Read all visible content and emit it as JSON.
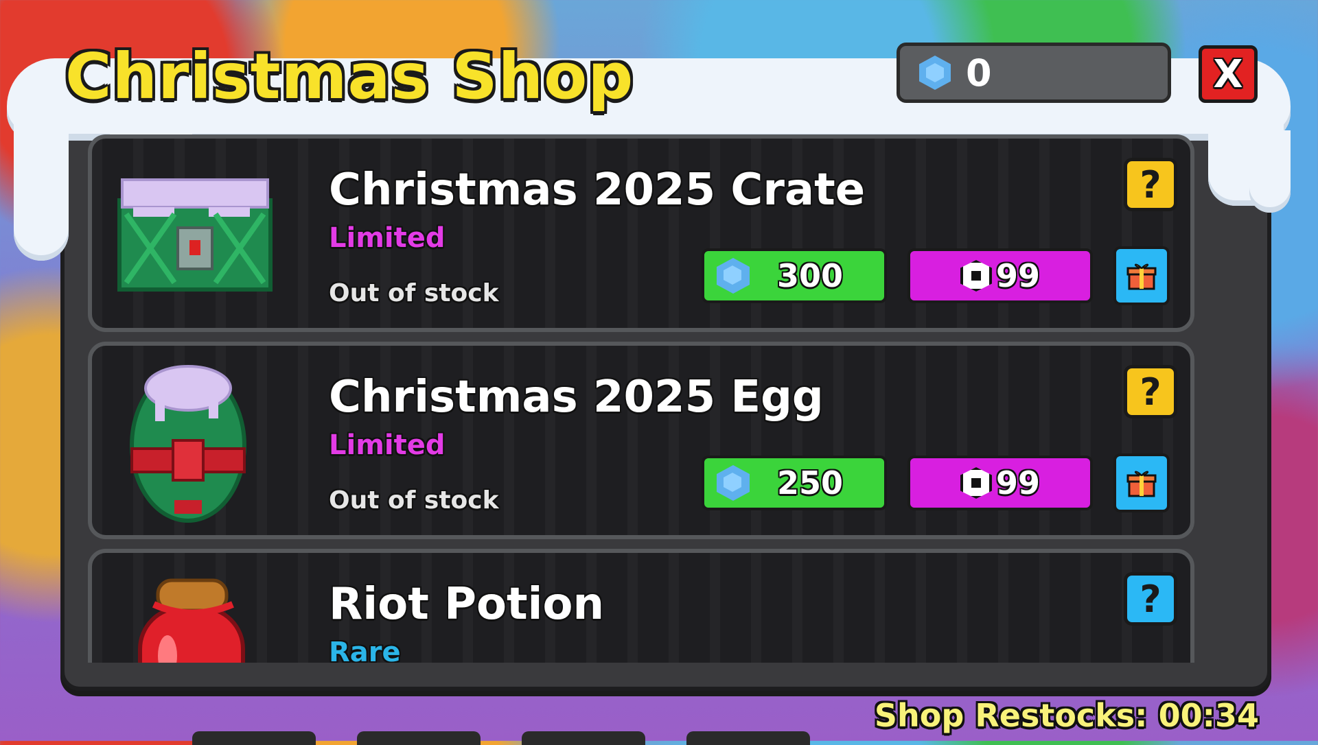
{
  "shop": {
    "title": "Christmas Shop",
    "currency_balance": "0",
    "close_label": "X",
    "restock_text": "Shop Restocks: 00:34"
  },
  "items": [
    {
      "name": "Christmas 2025 Crate",
      "rarity": "Limited",
      "stock": "Out of stock",
      "gem_price": "300",
      "robux_price": "99",
      "info_label": "?"
    },
    {
      "name": "Christmas 2025 Egg",
      "rarity": "Limited",
      "stock": "Out of stock",
      "gem_price": "250",
      "robux_price": "99",
      "info_label": "?"
    },
    {
      "name": "Riot Potion",
      "rarity": "Rare",
      "info_label": "?"
    }
  ],
  "icons": {
    "currency": "gem-hexagon-icon",
    "robux": "robux-icon",
    "gift": "gift-icon"
  },
  "colors": {
    "title": "#f8e22a",
    "gem_button": "#3bd43b",
    "robux_button": "#d81fe0",
    "limited": "#e33be6",
    "rare": "#2bb5e8",
    "close": "#e22222"
  }
}
